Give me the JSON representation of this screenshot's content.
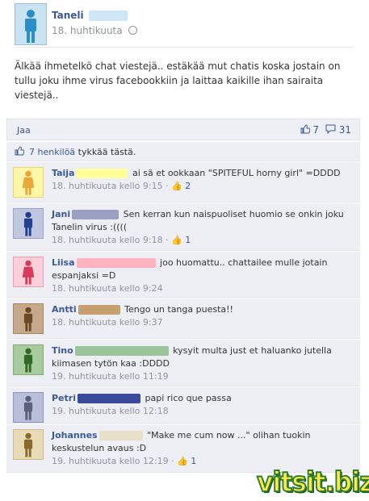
{
  "post": {
    "author": "Taneli",
    "timestamp": "18. huhtikuuta",
    "privacy_icon": "globe-icon",
    "body": "Älkää ihmetelkö chat viestejä.. estäkää mut chatis koska jostain on tullu joku ihme virus facebookkiin ja laittaa kaikille ihan sairaita viestejä..",
    "avatar_color": "#c9e3f3",
    "avatar_figure_color": "#2a8fc9"
  },
  "actions": {
    "share_label": "Jaa",
    "like_count": "7",
    "comment_count": "31"
  },
  "likes": {
    "link_text": "7 henkilöä",
    "suffix_text": " tykkää tästä."
  },
  "comments": [
    {
      "name": "Taija",
      "redact_color": "#ffff99",
      "redact_width": 64,
      "text": "ai sä et ookkaan \"SPITEFUL horny girl\" =DDDD",
      "meta": "18. huhtikuuta kello 9:15",
      "likes": "2",
      "avatar_bg": "#fff6a8",
      "avatar_border": "#e7d76a",
      "figure_color": "#e8a73a"
    },
    {
      "name": "Jani",
      "redact_color": "#9aa1c4",
      "redact_width": 58,
      "text": "Sen kerran kun naispuoliset huomio se onkin joku Tanelin virus :((((",
      "meta": "18. huhtikuuta kello 9:18",
      "likes": "1",
      "avatar_bg": "#c1c7de",
      "avatar_border": "#9aa1c4",
      "figure_color": "#1f3f8f"
    },
    {
      "name": "Liisa",
      "redact_color": "#ffb3c1",
      "redact_width": 98,
      "text": "joo huomattu.. chattailee mulle jotain espanjaksi =D",
      "meta": "18. huhtikuuta kello 9:24",
      "likes": "",
      "avatar_bg": "#fbd0da",
      "avatar_border": "#f09bb0",
      "figure_color": "#d83b5a"
    },
    {
      "name": "Antti",
      "redact_color": "#c89f6f",
      "redact_width": 52,
      "text": "Tengo un tanga puesta!!",
      "meta": "18. huhtikuuta kello 9:37",
      "likes": "",
      "avatar_bg": "#c6a98a",
      "avatar_border": "#a98460",
      "figure_color": "#6a4824"
    },
    {
      "name": "Tino",
      "redact_color": "#9cc49c",
      "redact_width": 116,
      "text": "kysyit multa just et haluanko jutella kiimasen tytön kaa :DDDD",
      "meta": "19. huhtikuuta kello 11:19",
      "likes": "",
      "avatar_bg": "#a9cc9f",
      "avatar_border": "#7faa73",
      "figure_color": "#2d6b25"
    },
    {
      "name": "Petri",
      "redact_color": "#3b4a9a",
      "redact_width": 78,
      "text": "papi rico que passa",
      "meta": "19. huhtikuuta kello 12:18",
      "likes": "",
      "avatar_bg": "#b9bfd9",
      "avatar_border": "#8e96bf",
      "figure_color": "#5a5f7a"
    },
    {
      "name": "Johannes",
      "redact_color": "#e8e0c8",
      "redact_width": 54,
      "text": "\"Make me cum now ...\" olihan tuokin keskustelun avaus :D",
      "meta": "19. huhtikuuta kello 12:19",
      "likes": "1",
      "avatar_bg": "#e8dcb8",
      "avatar_border": "#cdbd8b",
      "figure_color": "#8a6a2a"
    }
  ],
  "watermark": "vitsit.biz",
  "colors": {
    "link": "#3b5998",
    "meta": "#90949c",
    "panel": "#edeff4"
  }
}
